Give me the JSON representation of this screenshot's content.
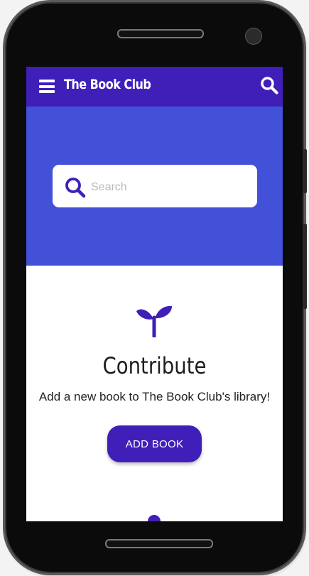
{
  "app": {
    "title": "The Book Club"
  },
  "search": {
    "placeholder": "Search"
  },
  "contribute": {
    "title": "Contribute",
    "description": "Add a new book to The Book Club's library!",
    "button_label": "ADD BOOK"
  },
  "colors": {
    "primary": "#3f1fb8",
    "hero": "#4351d8"
  },
  "icons": {
    "menu": "menu-icon",
    "search": "search-icon",
    "contribute": "sprout-icon"
  }
}
